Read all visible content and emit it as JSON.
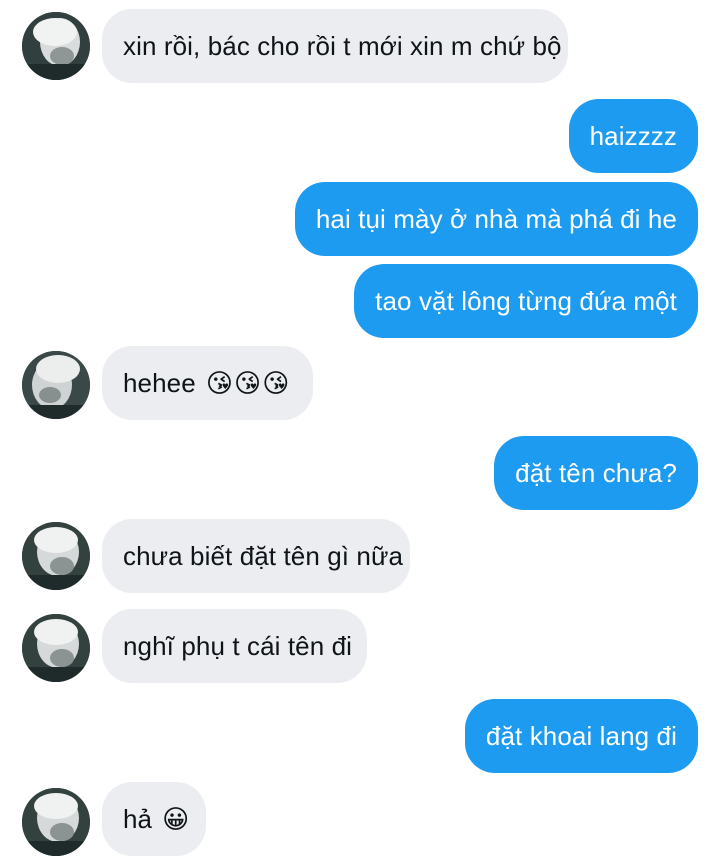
{
  "conversation": {
    "messages": [
      {
        "side": "in",
        "text": "xin rồi, bác cho rồi t mới xin m chứ bộ",
        "avatar": "avatar"
      },
      {
        "side": "out",
        "text": "haizzzz"
      },
      {
        "side": "out",
        "text": "hai tụi mày ở nhà mà phá đi he"
      },
      {
        "side": "out",
        "text": "tao vặt lông từng đứa một"
      },
      {
        "side": "in",
        "text": "hehee",
        "emojis": [
          "😘",
          "😘",
          "😘"
        ],
        "avatar": "avatar"
      },
      {
        "side": "out",
        "text": "đặt tên chưa?"
      },
      {
        "side": "in",
        "text": "chưa biết đặt tên gì nữa",
        "avatar": "avatar"
      },
      {
        "side": "in",
        "text": "nghĩ phụ t cái tên đi",
        "avatar": "avatar"
      },
      {
        "side": "out",
        "text": "đặt khoai lang đi"
      },
      {
        "side": "in",
        "text": "hả",
        "emojis": [
          "😀"
        ],
        "avatar": "avatar"
      }
    ]
  },
  "colors": {
    "incoming_bubble": "#ebedf0",
    "outgoing_bubble": "#1d9bf0",
    "incoming_text": "#0f1419",
    "outgoing_text": "#ffffff"
  }
}
